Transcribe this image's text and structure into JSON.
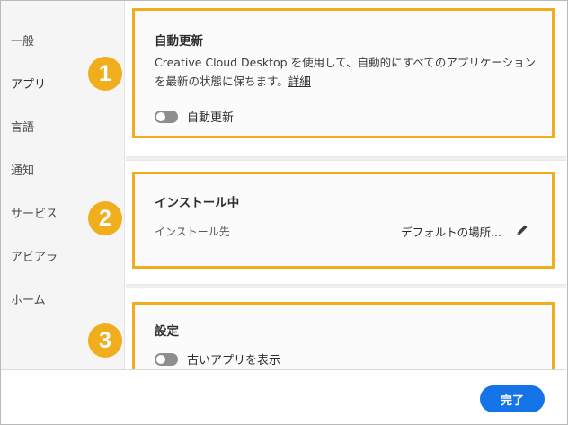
{
  "sidebar": {
    "items": [
      {
        "label": "一般"
      },
      {
        "label": "アプリ"
      },
      {
        "label": "言語"
      },
      {
        "label": "通知"
      },
      {
        "label": "サービス"
      },
      {
        "label": "アビアラ"
      },
      {
        "label": "ホーム"
      }
    ]
  },
  "auto_update": {
    "title": "自動更新",
    "description": "Creative Cloud Desktop を使用して、自動的にすべてのアプリケーションを最新の状態に保ちます。",
    "detail_link": "詳細",
    "toggle_label": "自動更新",
    "toggle_on": false
  },
  "install": {
    "title": "インストール中",
    "location_label": "インストール先",
    "location_value": "デフォルトの場所..."
  },
  "settings": {
    "title": "設定",
    "toggle_label": "古いアプリを表示",
    "toggle_on": false
  },
  "badges": [
    "1",
    "2",
    "3"
  ],
  "footer": {
    "done_label": "完了"
  },
  "colors": {
    "highlight": "#f0ad1c",
    "primary_button": "#1473e6"
  }
}
